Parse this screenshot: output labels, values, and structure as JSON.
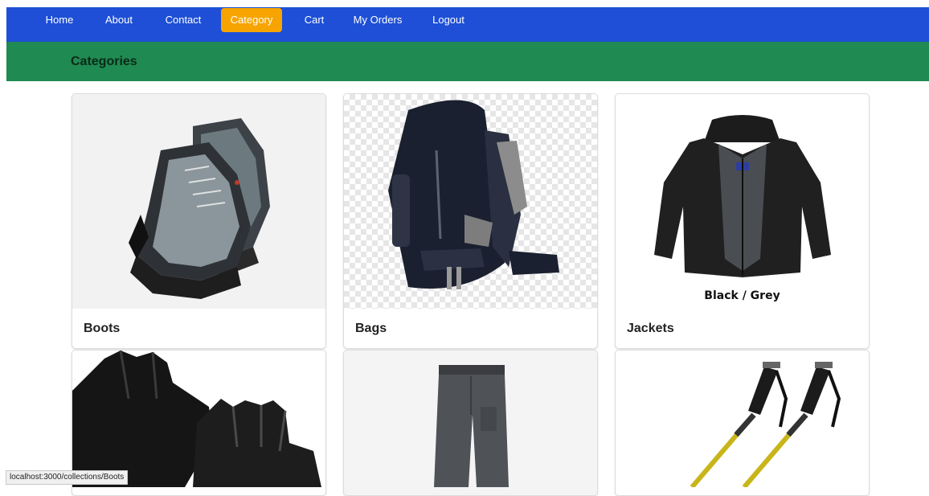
{
  "nav": {
    "items": [
      {
        "label": "Home"
      },
      {
        "label": "About"
      },
      {
        "label": "Contact"
      },
      {
        "label": "Category"
      },
      {
        "label": "Cart"
      },
      {
        "label": "My Orders"
      },
      {
        "label": "Logout"
      }
    ],
    "active": "Category"
  },
  "header": {
    "title": "Categories"
  },
  "categories": [
    {
      "label": "Boots",
      "image": "hiking-boot-icon"
    },
    {
      "label": "Bags",
      "image": "backpack-icon"
    },
    {
      "label": "Jackets",
      "image": "jacket-icon",
      "caption": "Black / Grey"
    },
    {
      "label": "",
      "image": "gloves-icon"
    },
    {
      "label": "",
      "image": "pants-icon"
    },
    {
      "label": "",
      "image": "trekking-poles-icon"
    }
  ],
  "status": {
    "url": "localhost:3000/collections/Boots"
  },
  "colors": {
    "navbar": "#1e4fd6",
    "active": "#f7a400",
    "header": "#1f8a52"
  }
}
